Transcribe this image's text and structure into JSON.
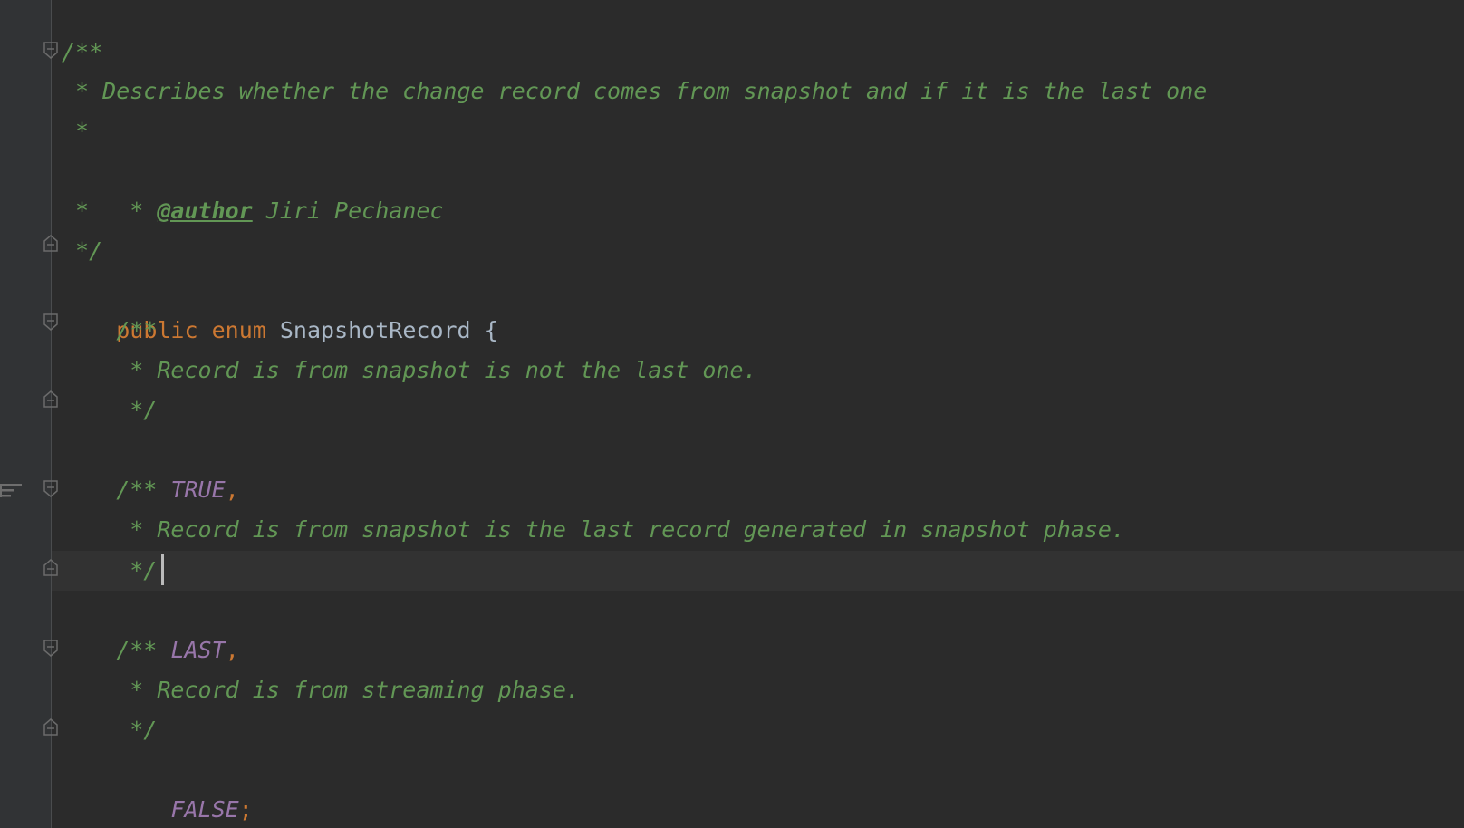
{
  "code": {
    "l1": {
      "comment": "/**"
    },
    "l2": {
      "comment": " * Describes whether the change record comes from snapshot and if it is the last one"
    },
    "l3": {
      "comment": " *"
    },
    "l4": {
      "prefix": " * ",
      "tag": "@author",
      "rest": " Jiri Pechanec"
    },
    "l5": {
      "comment": " *"
    },
    "l6": {
      "comment": " */"
    },
    "l7": {
      "kw1": "public",
      "kw2": "enum",
      "class_name": "SnapshotRecord",
      "brace": "{"
    },
    "l8": {
      "comment": "    /**"
    },
    "l9": {
      "comment": "     * Record is from snapshot is not the last one."
    },
    "l10": {
      "comment": "     */"
    },
    "l11": {
      "indent": "    ",
      "constant": "TRUE",
      "punct": ","
    },
    "l12": {
      "comment": "    /**"
    },
    "l13": {
      "comment": "     * Record is from snapshot is the last record generated in snapshot phase."
    },
    "l14": {
      "comment": "     */"
    },
    "l15": {
      "indent": "    ",
      "constant": "LAST",
      "punct": ","
    },
    "l16": {
      "comment": "    /**"
    },
    "l17": {
      "comment": "     * Record is from streaming phase."
    },
    "l18": {
      "comment": "     */"
    },
    "l19": {
      "indent": "    ",
      "constant": "FALSE",
      "punct": ";"
    }
  },
  "colors": {
    "background": "#2b2b2b",
    "comment": "#629755",
    "keyword": "#cc7832",
    "constant": "#9876aa",
    "text": "#a9b7c6"
  },
  "icons": {
    "fold_open": "fold-open-icon",
    "fold_close": "fold-close-icon",
    "soft_wrap": "soft-wrap-icon"
  }
}
